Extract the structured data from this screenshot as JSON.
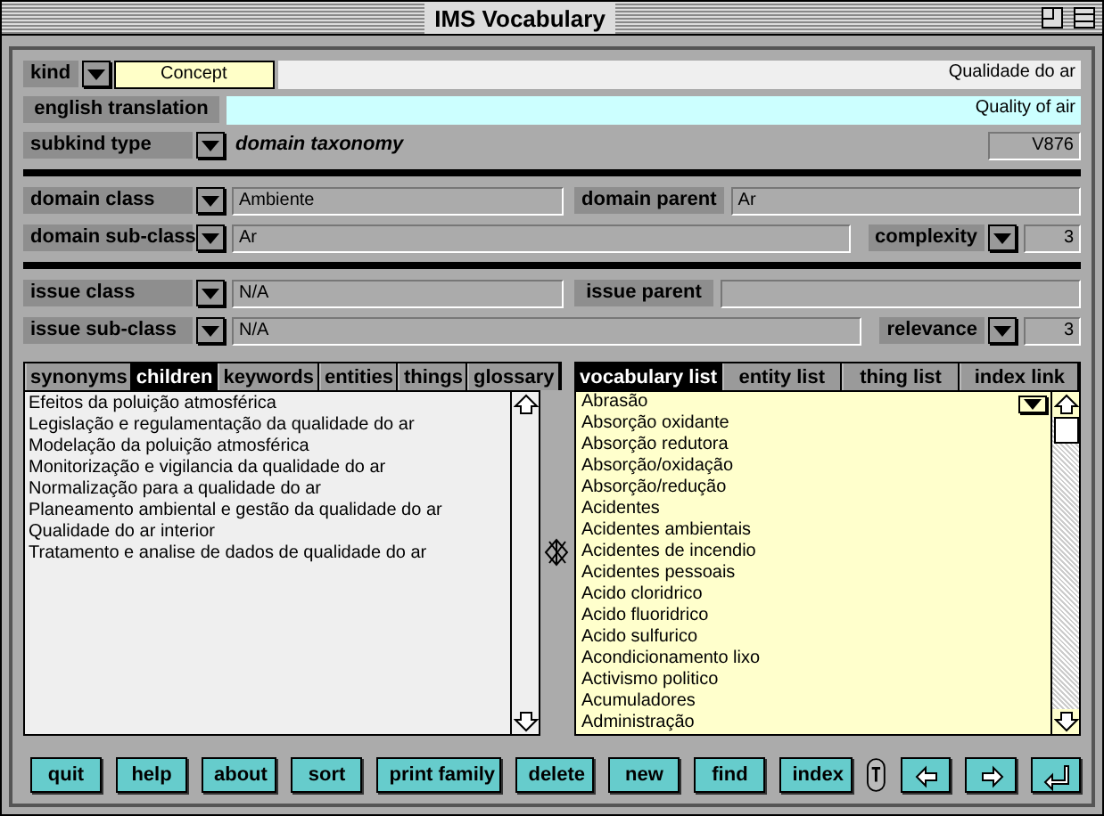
{
  "window": {
    "title": "IMS Vocabulary"
  },
  "kind": {
    "label": "kind",
    "value": "Concept"
  },
  "term": {
    "value": "Qualidade do ar"
  },
  "english_translation": {
    "label": "english translation",
    "value": "Quality of air"
  },
  "subkind_type": {
    "label": "subkind type",
    "value": "domain taxonomy"
  },
  "code": {
    "value": "V876"
  },
  "domain_class": {
    "label": "domain class",
    "value": "Ambiente"
  },
  "domain_parent": {
    "label": "domain parent",
    "value": "Ar"
  },
  "domain_sub_class": {
    "label": "domain sub-class",
    "value": "Ar"
  },
  "complexity": {
    "label": "complexity",
    "value": "3"
  },
  "issue_class": {
    "label": "issue class",
    "value": "N/A"
  },
  "issue_parent": {
    "label": "issue parent"
  },
  "issue_sub_class": {
    "label": "issue sub-class",
    "value": "N/A"
  },
  "relevance": {
    "label": "relevance",
    "value": "3"
  },
  "left_tabs": [
    {
      "label": "synonyms",
      "selected": false
    },
    {
      "label": "children",
      "selected": true
    },
    {
      "label": "keywords",
      "selected": false
    },
    {
      "label": "entities",
      "selected": false
    },
    {
      "label": "things",
      "selected": false
    },
    {
      "label": "glossary",
      "selected": false
    }
  ],
  "children_list": [
    "Efeitos da poluição atmosférica",
    "Legislação e regulamentação da qualidade do ar",
    "Modelação da poluição atmosférica",
    "Monitorização e vigilancia da qualidade do ar",
    "Normalização para a qualidade do ar",
    "Planeamento ambiental e gestão da qualidade do ar",
    "Qualidade do ar interior",
    "Tratamento e analise de dados de qualidade do ar"
  ],
  "right_tabs": [
    {
      "label": "vocabulary list",
      "selected": true
    },
    {
      "label": "entity list",
      "selected": false
    },
    {
      "label": "thing list",
      "selected": false
    },
    {
      "label": "index link",
      "selected": false
    }
  ],
  "vocabulary_list": [
    "Abrasão",
    "Absorção oxidante",
    "Absorção redutora",
    "Absorção/oxidação",
    "Absorção/redução",
    "Acidentes",
    "Acidentes ambientais",
    "Acidentes de incendio",
    "Acidentes pessoais",
    "Acido cloridrico",
    "Acido fluoridrico",
    "Acido sulfurico",
    "Acondicionamento lixo",
    "Activismo politico",
    "Acumuladores",
    "Administração"
  ],
  "buttons": [
    "quit",
    "help",
    "about",
    "sort",
    "print family",
    "delete",
    "new",
    "find",
    "index"
  ]
}
